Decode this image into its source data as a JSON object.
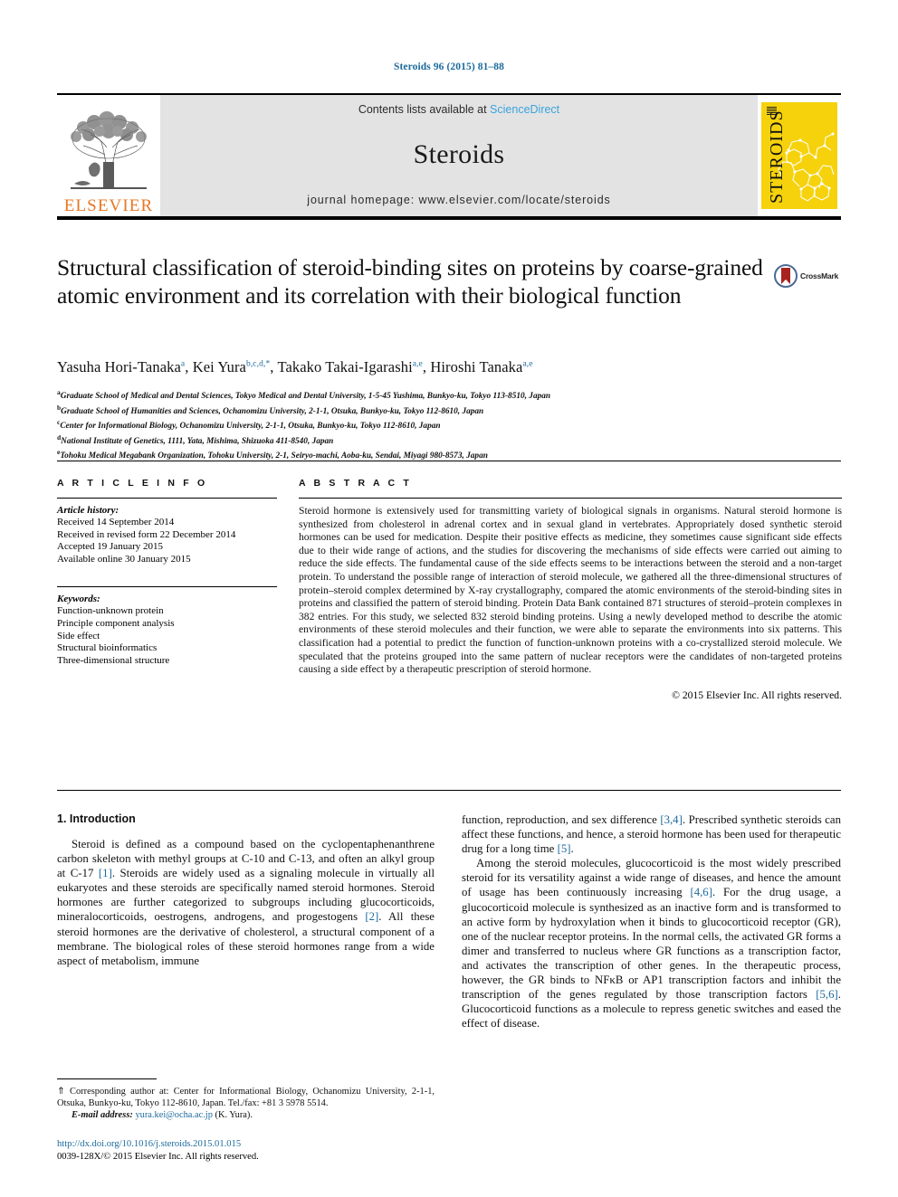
{
  "running_head": "Steroids 96 (2015) 81–88",
  "masthead": {
    "publisher_name": "ELSEVIER",
    "contents_prefix": "Contents lists available at ",
    "contents_link": "ScienceDirect",
    "journal_name": "Steroids",
    "homepage": "journal homepage: www.elsevier.com/locate/steroids",
    "cover_title": "STEROIDS"
  },
  "article": {
    "title": "Structural classification of steroid-binding sites on proteins by coarse-grained atomic environment and its correlation with their biological function",
    "crossmark_label": "CrossMark",
    "authors_plain": "Yasuha Hori-Tanaka a, Kei Yura b,c,d,*, Takako Takai-Igarashi a,e, Hiroshi Tanaka a,e",
    "authors": [
      {
        "name": "Yasuha Hori-Tanaka",
        "sup": "a"
      },
      {
        "name": "Kei Yura",
        "sup": "b,c,d,*"
      },
      {
        "name": "Takako Takai-Igarashi",
        "sup": "a,e"
      },
      {
        "name": "Hiroshi Tanaka",
        "sup": "a,e"
      }
    ],
    "affiliations": [
      {
        "mark": "a",
        "text": "Graduate School of Medical and Dental Sciences, Tokyo Medical and Dental University, 1-5-45 Yushima, Bunkyo-ku, Tokyo 113-8510, Japan"
      },
      {
        "mark": "b",
        "text": "Graduate School of Humanities and Sciences, Ochanomizu University, 2-1-1, Otsuka, Bunkyo-ku, Tokyo 112-8610, Japan"
      },
      {
        "mark": "c",
        "text": "Center for Informational Biology, Ochanomizu University, 2-1-1, Otsuka, Bunkyo-ku, Tokyo 112-8610, Japan"
      },
      {
        "mark": "d",
        "text": "National Institute of Genetics, 1111, Yata, Mishima, Shizuoka 411-8540, Japan"
      },
      {
        "mark": "e",
        "text": "Tohoku Medical Megabank Organization, Tohoku University, 2-1, Seiryo-machi, Aoba-ku, Sendai, Miyagi 980-8573, Japan"
      }
    ]
  },
  "article_info": {
    "kicker": "A R T I C L E   I N F O",
    "history_label": "Article history:",
    "history": [
      "Received 14 September 2014",
      "Received in revised form 22 December 2014",
      "Accepted 19 January 2015",
      "Available online 30 January 2015"
    ],
    "keywords_label": "Keywords:",
    "keywords": [
      "Function-unknown protein",
      "Principle component analysis",
      "Side effect",
      "Structural bioinformatics",
      "Three-dimensional structure"
    ]
  },
  "abstract": {
    "kicker": "A B S T R A C T",
    "text": "Steroid hormone is extensively used for transmitting variety of biological signals in organisms. Natural steroid hormone is synthesized from cholesterol in adrenal cortex and in sexual gland in vertebrates. Appropriately dosed synthetic steroid hormones can be used for medication. Despite their positive effects as medicine, they sometimes cause significant side effects due to their wide range of actions, and the studies for discovering the mechanisms of side effects were carried out aiming to reduce the side effects. The fundamental cause of the side effects seems to be interactions between the steroid and a non-target protein. To understand the possible range of interaction of steroid molecule, we gathered all the three-dimensional structures of protein–steroid complex determined by X-ray crystallography, compared the atomic environments of the steroid-binding sites in proteins and classified the pattern of steroid binding. Protein Data Bank contained 871 structures of steroid–protein complexes in 382 entries. For this study, we selected 832 steroid binding proteins. Using a newly developed method to describe the atomic environments of these steroid molecules and their function, we were able to separate the environments into six patterns. This classification had a potential to predict the function of function-unknown proteins with a co-crystallized steroid molecule. We speculated that the proteins grouped into the same pattern of nuclear receptors were the candidates of non-targeted proteins causing a side effect by a therapeutic prescription of steroid hormone.",
    "copyright": "© 2015 Elsevier Inc. All rights reserved."
  },
  "introduction": {
    "heading": "1. Introduction",
    "left_paragraph_1_a": "Steroid is defined as a compound based on the cyclopentaphenanthrene carbon skeleton with methyl groups at C-10 and C-13, and often an alkyl group at C-17 ",
    "left_ref_1": "[1]",
    "left_paragraph_1_b": ". Steroids are widely used as a signaling molecule in virtually all eukaryotes and these steroids are specifically named steroid hormones. Steroid hormones are further categorized to subgroups including glucocorticoids, mineralocorticoids, oestrogens, androgens, and progestogens ",
    "left_ref_2": "[2]",
    "left_paragraph_1_c": ". All these steroid hormones are the derivative of cholesterol, a structural component of a membrane. The biological roles of these steroid hormones range from a wide aspect of metabolism, immune",
    "right_paragraph_1_a": "function, reproduction, and sex difference ",
    "right_ref_34": "[3,4]",
    "right_paragraph_1_b": ". Prescribed synthetic steroids can affect these functions, and hence, a steroid hormone has been used for therapeutic drug for a long time ",
    "right_ref_5": "[5]",
    "right_paragraph_1_c": ".",
    "right_paragraph_2_a": "Among the steroid molecules, glucocorticoid is the most widely prescribed steroid for its versatility against a wide range of diseases, and hence the amount of usage has been continuously increasing ",
    "right_ref_46": "[4,6]",
    "right_paragraph_2_b": ". For the drug usage, a glucocorticoid molecule is synthesized as an inactive form and is transformed to an active form by hydroxylation when it binds to glucocorticoid receptor (GR), one of the nuclear receptor proteins. In the normal cells, the activated GR forms a dimer and transferred to nucleus where GR functions as a transcription factor, and activates the transcription of other genes. In the therapeutic process, however, the GR binds to NFκB or AP1 transcription factors and inhibit the transcription of the genes regulated by those transcription factors ",
    "right_ref_56": "[5,6]",
    "right_paragraph_2_c": ". Glucocorticoid functions as a molecule to repress genetic switches and eased the effect of disease."
  },
  "footnote": {
    "marker": "⇑",
    "corresponding_text": " Corresponding author at: Center for Informational Biology, Ochanomizu University, 2-1-1, Otsuka, Bunkyo-ku, Tokyo 112-8610, Japan. Tel./fax: +81 3 5978 5514.",
    "email_label": "E-mail address:",
    "email": "yura.kei@ocha.ac.jp",
    "email_suffix": " (K. Yura)."
  },
  "footer": {
    "doi": "http://dx.doi.org/10.1016/j.steroids.2015.01.015",
    "issn_line": "0039-128X/© 2015 Elsevier Inc. All rights reserved."
  },
  "colors": {
    "link_blue": "#1b6a9c",
    "sciencedirect_blue": "#3aa3dd",
    "elsevier_orange": "#E87722",
    "cover_yellow": "#f5d20c",
    "masthead_gray": "#e3e3e3"
  }
}
